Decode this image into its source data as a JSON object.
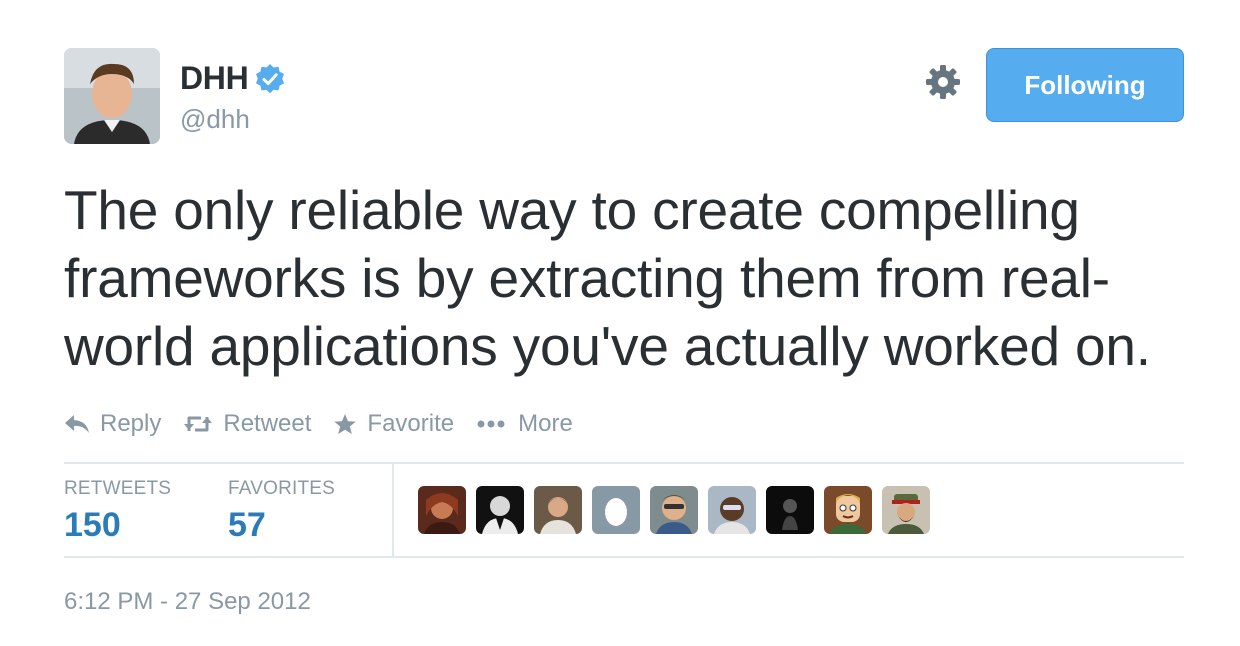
{
  "author": {
    "display_name": "DHH",
    "handle": "@dhh",
    "avatar_icon": "profile-photo",
    "verified_icon": "verified-badge-icon"
  },
  "header": {
    "follow_button_label": "Following",
    "settings_icon": "gear-icon"
  },
  "tweet": {
    "text": "The only reliable way to create compelling frameworks is by extracting them from real-world applications you've actually worked on."
  },
  "actions": {
    "reply_label": "Reply",
    "retweet_label": "Retweet",
    "favorite_label": "Favorite",
    "more_label": "More"
  },
  "stats": {
    "retweets_label": "RETWEETS",
    "retweets_count": "150",
    "favorites_label": "FAVORITES",
    "favorites_count": "57"
  },
  "favoriters_avatars": [
    "avatar-icon",
    "avatar-icon",
    "avatar-icon",
    "egg-avatar-icon",
    "avatar-icon",
    "avatar-icon",
    "avatar-icon",
    "cartoon-avatar-icon",
    "avatar-icon"
  ],
  "timestamp": "6:12 PM - 27 Sep 2012",
  "colors": {
    "accent": "#55acee",
    "link": "#2b7bb9",
    "muted": "#8899a6",
    "text": "#292f33"
  }
}
